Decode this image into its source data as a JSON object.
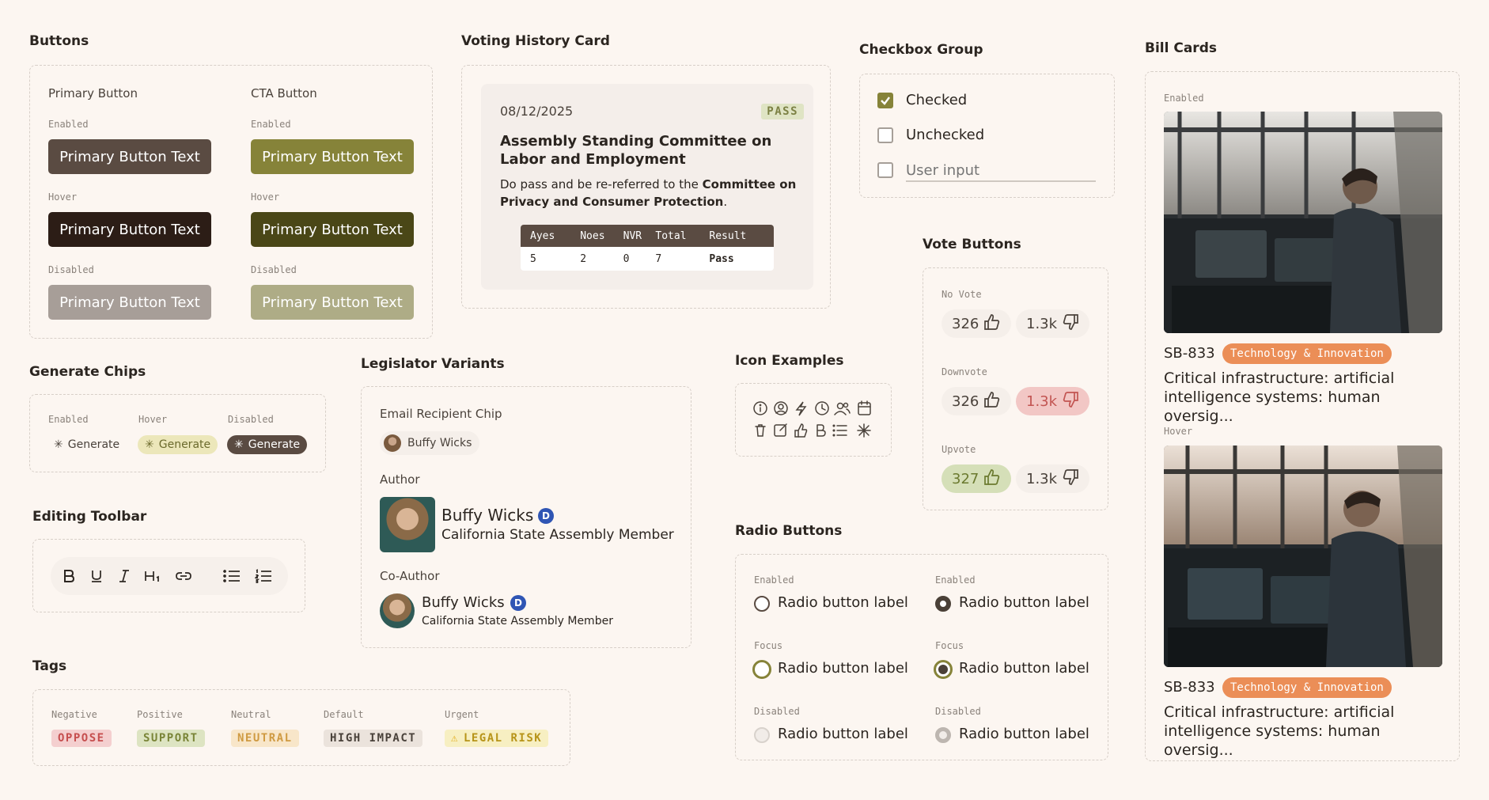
{
  "buttons": {
    "title": "Buttons",
    "primary_heading": "Primary Button",
    "cta_heading": "CTA Button",
    "states": [
      "Enabled",
      "Hover",
      "Disabled"
    ],
    "label": "Primary Button Text"
  },
  "voting": {
    "title": "Voting History Card",
    "date": "08/12/2025",
    "badge": "PASS",
    "committee": "Assembly Standing Committee on Labor and Employment",
    "motion_prefix": "Do pass and be re-referred to the ",
    "motion_committee": "Committee on Privacy and Consumer Protection",
    "motion_suffix": ".",
    "headers": [
      "Ayes",
      "Noes",
      "NVR",
      "Total",
      "Result"
    ],
    "row": [
      "5",
      "2",
      "0",
      "7",
      "Pass"
    ]
  },
  "checkbox": {
    "title": "Checkbox Group",
    "checked": "Checked",
    "unchecked": "Unchecked",
    "input_placeholder": "User input"
  },
  "bills": {
    "title": "Bill Cards",
    "enabled": "Enabled",
    "hover": "Hover",
    "items": [
      {
        "id": "SB-833",
        "tag": "Technology & Innovation",
        "title": "Critical infrastructure: artificial intelligence systems: human oversig..."
      },
      {
        "id": "SB-833",
        "tag": "Technology & Innovation",
        "title": "Critical infrastructure: artificial intelligence systems: human oversig..."
      }
    ]
  },
  "generate": {
    "title": "Generate Chips",
    "states": [
      "Enabled",
      "Hover",
      "Disabled"
    ],
    "label": "Generate"
  },
  "legislator": {
    "title": "Legislator Variants",
    "email_heading": "Email Recipient Chip",
    "name": "Buffy Wicks",
    "author_heading": "Author",
    "party": "D",
    "role": "California State Assembly Member",
    "coauthor_heading": "Co-Author"
  },
  "icons": {
    "title": "Icon Examples",
    "row1": [
      "info-icon",
      "user-circle-icon",
      "lightning-icon",
      "clock-icon",
      "users-icon",
      "calendar-icon"
    ],
    "row2": [
      "trash-icon",
      "edit-icon",
      "thumbs-up-icon",
      "bold-icon",
      "list-icon",
      "sparkle-icon"
    ]
  },
  "vote_buttons": {
    "title": "Vote Buttons",
    "groups": [
      {
        "state": "No Vote",
        "up": "326",
        "down": "1.3k"
      },
      {
        "state": "Downvote",
        "up": "326",
        "down": "1.3k"
      },
      {
        "state": "Upvote",
        "up": "327",
        "down": "1.3k"
      }
    ]
  },
  "toolbar": {
    "title": "Editing Toolbar"
  },
  "tags": {
    "title": "Tags",
    "items": [
      {
        "state": "Negative",
        "label": "OPPOSE"
      },
      {
        "state": "Positive",
        "label": "SUPPORT"
      },
      {
        "state": "Neutral",
        "label": "NEUTRAL"
      },
      {
        "state": "Default",
        "label": "HIGH IMPACT"
      },
      {
        "state": "Urgent",
        "label": "LEGAL RISK"
      }
    ]
  },
  "radio": {
    "title": "Radio Buttons",
    "label": "Radio button label",
    "states": [
      "Enabled",
      "Focus",
      "Disabled"
    ]
  },
  "colors": {
    "primary": "#5a4b42",
    "primary_hover": "#2c1d16",
    "primary_disabled": "#a79e98",
    "cta": "#868339",
    "cta_hover": "#4a4717",
    "cta_disabled": "#aeac86",
    "background": "#fcf6f1"
  }
}
